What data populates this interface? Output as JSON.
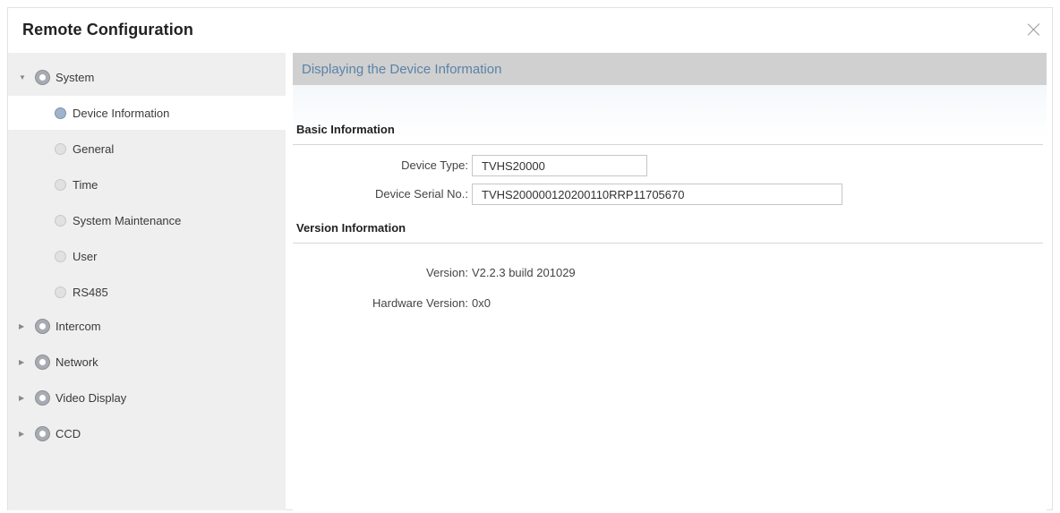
{
  "window": {
    "title": "Remote Configuration",
    "close_icon": "close-icon"
  },
  "sidebar": {
    "groups": [
      {
        "label": "System",
        "expanded": true,
        "items": [
          {
            "label": "Device Information",
            "selected": true
          },
          {
            "label": "General"
          },
          {
            "label": "Time"
          },
          {
            "label": "System Maintenance"
          },
          {
            "label": "User"
          },
          {
            "label": "RS485"
          }
        ]
      },
      {
        "label": "Intercom",
        "expanded": false
      },
      {
        "label": "Network",
        "expanded": false
      },
      {
        "label": "Video Display",
        "expanded": false
      },
      {
        "label": "CCD",
        "expanded": false
      }
    ]
  },
  "content": {
    "header": "Displaying the Device Information",
    "basic": {
      "title": "Basic Information",
      "device_type_label": "Device Type:",
      "device_type_value": "TVHS20000",
      "serial_label": "Device Serial No.:",
      "serial_value": "TVHS200000120200110RRP11705670"
    },
    "version": {
      "title": "Version Information",
      "version_label": "Version:",
      "version_value": "V2.2.3 build 201029",
      "hardware_label": "Hardware Version:",
      "hardware_value": "0x0"
    }
  },
  "colors": {
    "header_text": "#5b82a8",
    "header_bg": "#d0d0d0",
    "sidebar_bg": "#efefef"
  }
}
